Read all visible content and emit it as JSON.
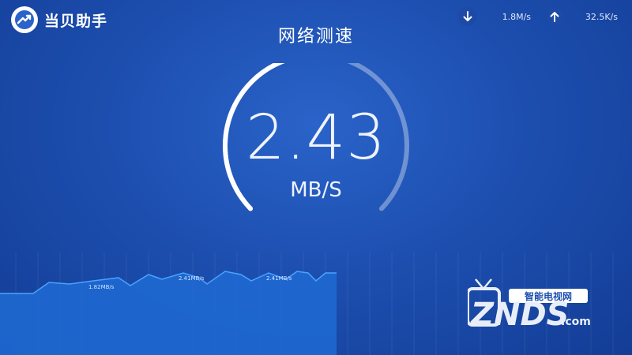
{
  "app": {
    "name": "当贝助手"
  },
  "header": {
    "download": {
      "icon": "arrow-down-icon",
      "value": "1.8M/s"
    },
    "upload": {
      "icon": "arrow-up-icon",
      "value": "32.5K/s"
    }
  },
  "page": {
    "title": "网络测速"
  },
  "gauge": {
    "value": "2.43",
    "unit": "MB/S",
    "progress": 0.5
  },
  "graph": {
    "labels": [
      "1.82MB/s",
      "2.41MB/s",
      "2.41MB/s"
    ]
  },
  "watermark": {
    "tagline": "智能电视网",
    "logo": "ZNDS",
    "suffix": ".com"
  },
  "colors": {
    "accent": "#ffffff",
    "background": "#1d4fb0",
    "graph_fill": "#1f6bd4",
    "graph_line": "#4aa3ff"
  }
}
